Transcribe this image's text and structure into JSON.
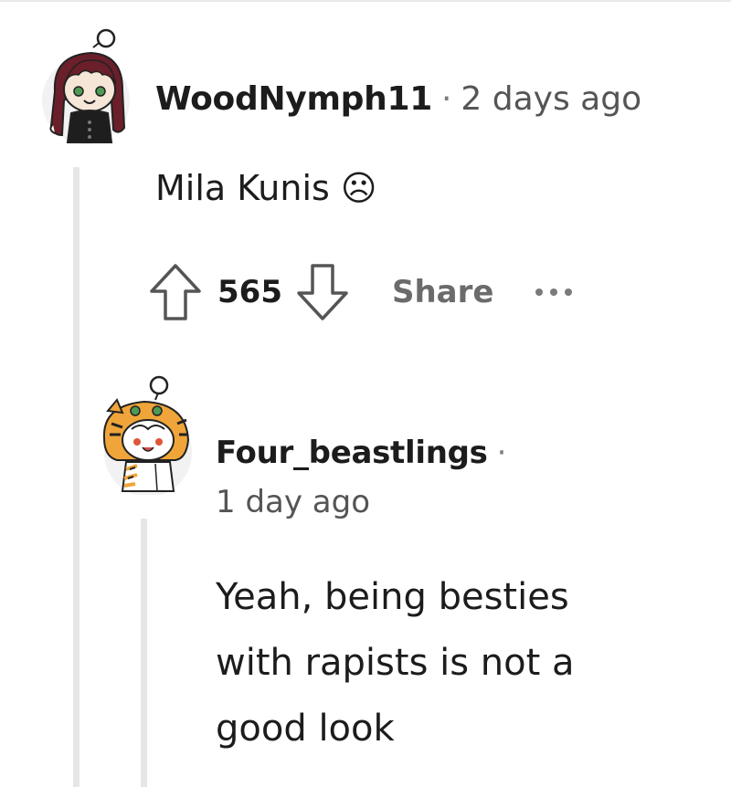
{
  "comments": [
    {
      "author": "WoodNymph11",
      "separator": "·",
      "timestamp": "2 days ago",
      "text": "Mila Kunis ☹",
      "score": "565",
      "share_label": "Share",
      "avatar_icon": "snoo-avatar-girl-dark-hair",
      "upvote_icon": "upvote-arrow-icon",
      "downvote_icon": "downvote-arrow-icon",
      "more_icon": "more-options-icon"
    },
    {
      "author": "Four_beastlings",
      "separator": "·",
      "timestamp": "1 day ago",
      "text_lines": [
        "Yeah, being besties",
        "with rapists is not a",
        "good look"
      ],
      "avatar_icon": "snoo-avatar-tiger-costume"
    }
  ],
  "colors": {
    "text": "#1c1c1c",
    "meta": "#555555",
    "thread_line": "#e6e6e6",
    "share": "#6b6b6b"
  }
}
